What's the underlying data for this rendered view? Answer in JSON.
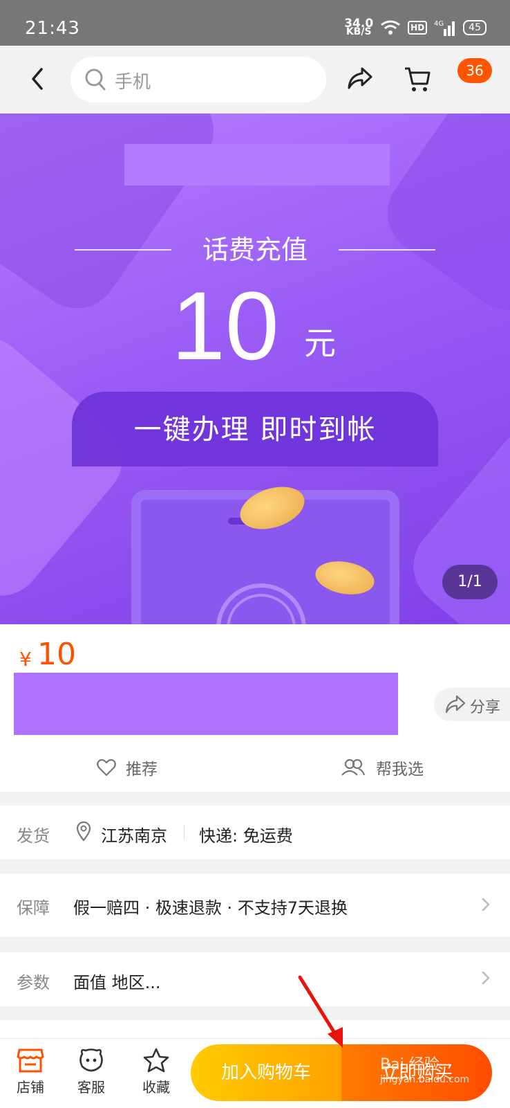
{
  "status": {
    "time": "21:43",
    "speed_value": "34.0",
    "speed_unit": "KB/S",
    "hd": "HD",
    "network": "4G",
    "battery": "45"
  },
  "topnav": {
    "search_placeholder": "手机",
    "cart_count": "36"
  },
  "banner": {
    "label": "话费充值",
    "amount": "10",
    "unit": "元",
    "slogan": "一键办理  即时到帐",
    "page_indicator": "1/1"
  },
  "product": {
    "currency": "¥",
    "price": "10",
    "share_label": "分享",
    "recommend_label": "推荐",
    "help_choose_label": "帮我选"
  },
  "shipping": {
    "label": "发货",
    "location": "江苏南京",
    "delivery": "快递: 免运费"
  },
  "guarantee": {
    "label": "保障",
    "text": "假一赔四 · 极速退款 · 不支持7天退换"
  },
  "params": {
    "label": "参数",
    "text": "面值 地区..."
  },
  "bottombar": {
    "store_label": "店铺",
    "service_label": "客服",
    "favorite_label": "收藏",
    "add_to_cart_label": "加入购物车",
    "buy_now_label": "立即购买"
  },
  "watermark": {
    "main": "Bai 经验",
    "sub": "jingyan.baidu.com"
  },
  "colors": {
    "accent": "#ff5000",
    "banner_purple": "#9a5cf5",
    "cart_button": "#ffb000",
    "buy_button": "#ff5a00"
  }
}
